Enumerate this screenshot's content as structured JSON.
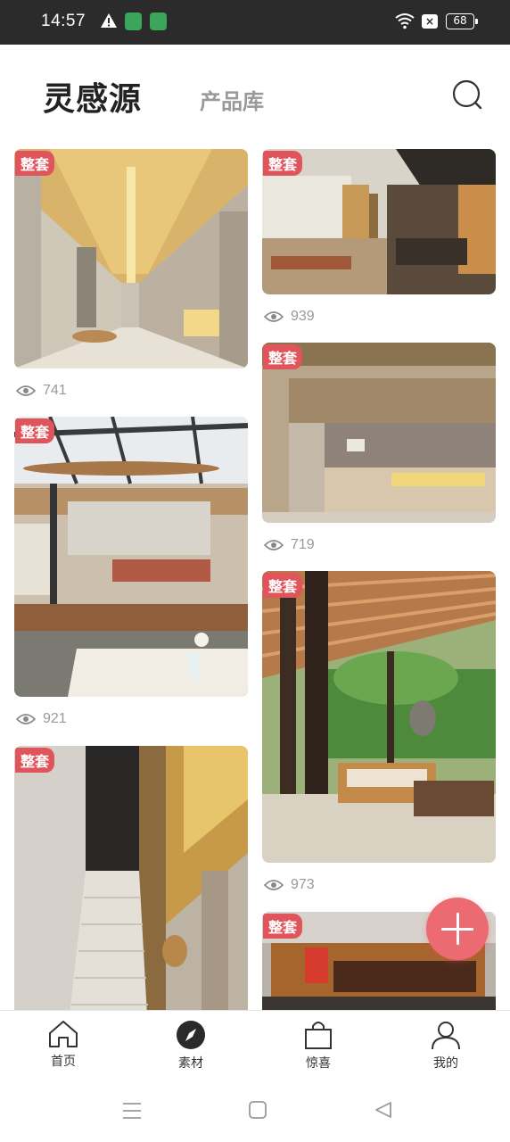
{
  "status_bar": {
    "time": "14:57",
    "battery": "68",
    "sim_indicator": "×",
    "icons": [
      "warning-icon",
      "app-notification-icon",
      "shield-app-icon",
      "wifi-icon",
      "sim-off-icon",
      "battery-icon"
    ]
  },
  "header": {
    "brand": "灵感源",
    "tab_product": "产品库",
    "search_icon": "search-icon"
  },
  "feed": {
    "cards": [
      {
        "badge": "整套",
        "views": "741",
        "scene": "corridor-gold-ceiling"
      },
      {
        "badge": "整套",
        "views": "939",
        "scene": "lounge-dark-wood"
      },
      {
        "badge": "整套",
        "views": "921",
        "scene": "restaurant-skylight"
      },
      {
        "badge": "整套",
        "views": "719",
        "scene": "reception-counter"
      },
      {
        "badge": "整套",
        "views": "",
        "scene": "stairway"
      },
      {
        "badge": "整套",
        "views": "973",
        "scene": "terrace-pergola"
      },
      {
        "badge": "整套",
        "views": "",
        "scene": "bar-counter"
      }
    ]
  },
  "fab": {
    "icon": "plus-icon"
  },
  "bottom_tabs": [
    {
      "label": "首页",
      "icon": "home-icon",
      "active": false
    },
    {
      "label": "素材",
      "icon": "compass-icon",
      "active": true
    },
    {
      "label": "惊喜",
      "icon": "shopping-bag-icon",
      "active": false
    },
    {
      "label": "我的",
      "icon": "user-icon",
      "active": false
    }
  ],
  "system_nav": [
    "menu-icon",
    "home-square-icon",
    "back-triangle-icon"
  ],
  "colors": {
    "status_bar_bg": "#2b2b2b",
    "badge": "#e0545c",
    "fab": "#ec6a71",
    "muted_text": "#999999"
  }
}
